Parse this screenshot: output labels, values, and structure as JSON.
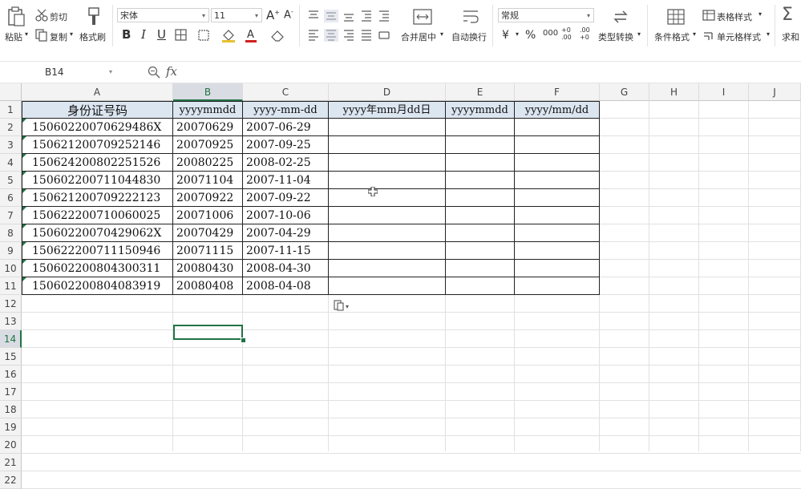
{
  "toolbar": {
    "paste": "粘贴",
    "cut": "剪切",
    "copy": "复制",
    "format_painter": "格式刷",
    "font_name": "宋体",
    "font_size": "11",
    "merge_center": "合并居中",
    "wrap_text": "自动换行",
    "number_format": "常规",
    "currency": "¥",
    "percent": "%",
    "thousands": "000",
    "inc_decimal": "+0 .00",
    "dec_decimal": ".00 +0",
    "type_convert": "类型转换",
    "cond_format": "条件格式",
    "table_style": "表格样式",
    "cell_style": "单元格样式",
    "sum": "求和"
  },
  "formula_bar": {
    "name_box": "B14",
    "fx": "fx",
    "value": ""
  },
  "columns": [
    "A",
    "B",
    "C",
    "D",
    "E",
    "F",
    "G",
    "H",
    "I",
    "J"
  ],
  "selected_column": "B",
  "rows": [
    "1",
    "2",
    "3",
    "4",
    "5",
    "6",
    "7",
    "8",
    "9",
    "10",
    "11",
    "12",
    "13",
    "14",
    "15",
    "16",
    "17",
    "18",
    "19",
    "20",
    "21",
    "22"
  ],
  "selected_row": "14",
  "table": {
    "headers": [
      "身份证号码",
      "yyyymmdd",
      "yyyy-mm-dd",
      "yyyy年mm月dd日",
      "yyyymmdd",
      "yyyy/mm/dd"
    ],
    "rows": [
      [
        "15060220070629486X",
        "20070629",
        "2007-06-29",
        "",
        "",
        ""
      ],
      [
        "150621200709252146",
        "20070925",
        "2007-09-25",
        "",
        "",
        ""
      ],
      [
        "150624200802251526",
        "20080225",
        "2008-02-25",
        "",
        "",
        ""
      ],
      [
        "150602200711044830",
        "20071104",
        "2007-11-04",
        "",
        "",
        ""
      ],
      [
        "150621200709222123",
        "20070922",
        "2007-09-22",
        "",
        "",
        ""
      ],
      [
        "150622200710060025",
        "20071006",
        "2007-10-06",
        "",
        "",
        ""
      ],
      [
        "15060220070429062X",
        "20070429",
        "2007-04-29",
        "",
        "",
        ""
      ],
      [
        "150622200711150946",
        "20071115",
        "2007-11-15",
        "",
        "",
        ""
      ],
      [
        "150602200804300311",
        "20080430",
        "2008-04-30",
        "",
        "",
        ""
      ],
      [
        "150602200804083919",
        "20080408",
        "2008-04-08",
        "",
        "",
        ""
      ]
    ]
  },
  "colors": {
    "accent": "#217346",
    "header_fill": "#dce6f1"
  }
}
